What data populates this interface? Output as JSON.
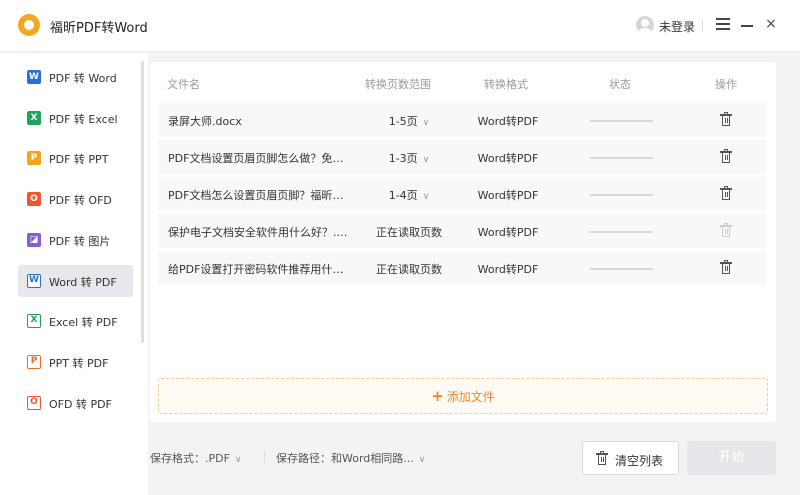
{
  "app": {
    "title": "福昕PDF转Word"
  },
  "titlebar": {
    "login": "未登录",
    "close": "×"
  },
  "sidebar": {
    "items": [
      {
        "label": "PDF 转 Word",
        "icon": "word-icon",
        "icon_text": "W",
        "color": "#2b6fd6",
        "active": false
      },
      {
        "label": "PDF 转 Excel",
        "icon": "excel-icon",
        "icon_text": "X",
        "color": "#21a35a",
        "active": false
      },
      {
        "label": "PDF 转 PPT",
        "icon": "ppt-icon",
        "icon_text": "P",
        "color": "#f4a51c",
        "active": false
      },
      {
        "label": "PDF 转 OFD",
        "icon": "ofd-icon",
        "icon_text": "O",
        "color": "#e8592f",
        "active": false
      },
      {
        "label": "PDF 转 图片",
        "icon": "image-icon",
        "icon_text": "◪",
        "color": "#8a5cd6",
        "active": false
      },
      {
        "label": "Word 转 PDF",
        "icon": "word-outline-icon",
        "icon_text": "W",
        "color": "#2b6fd6",
        "active": true
      },
      {
        "label": "Excel 转 PDF",
        "icon": "excel-outline-icon",
        "icon_text": "X",
        "color": "#21a35a",
        "active": false
      },
      {
        "label": "PPT 转 PDF",
        "icon": "ppt-outline-icon",
        "icon_text": "P",
        "color": "#f06a28",
        "active": false
      },
      {
        "label": "OFD 转 PDF",
        "icon": "ofd-outline-icon",
        "icon_text": "O",
        "color": "#e8592f",
        "active": false
      }
    ]
  },
  "table": {
    "headers": {
      "name": "文件名",
      "range": "转换页数范围",
      "format": "转换格式",
      "status": "状态",
      "action": "操作"
    },
    "rows": [
      {
        "name": "录屏大师.docx",
        "range": "1-5页",
        "has_dropdown": true,
        "format": "Word转PDF",
        "delete_enabled": true
      },
      {
        "name": "PDF文档设置页眉页脚怎么做？免费...",
        "range": "1-3页",
        "has_dropdown": true,
        "format": "Word转PDF",
        "delete_enabled": true
      },
      {
        "name": "PDF文档怎么设置页眉页脚？福昕保...",
        "range": "1-4页",
        "has_dropdown": true,
        "format": "Word转PDF",
        "delete_enabled": true
      },
      {
        "name": "保护电子文档安全软件用什么好？.d...",
        "range": "正在读取页数",
        "has_dropdown": false,
        "format": "Word转PDF",
        "delete_enabled": false
      },
      {
        "name": "给PDF设置打开密码软件推荐用什么...",
        "range": "正在读取页数",
        "has_dropdown": false,
        "format": "Word转PDF",
        "delete_enabled": true
      }
    ],
    "add_file": "添加文件"
  },
  "footer": {
    "save_format_label": "保存格式：",
    "save_format_value": ".PDF",
    "save_path_label": "保存路径：",
    "save_path_value": "和Word相同路...",
    "clear_button": "清空列表",
    "start_button": "开始"
  },
  "colors": {
    "accent": "#f5a623",
    "add_text": "#f0882a",
    "active_nav": "#e6e8ec"
  }
}
